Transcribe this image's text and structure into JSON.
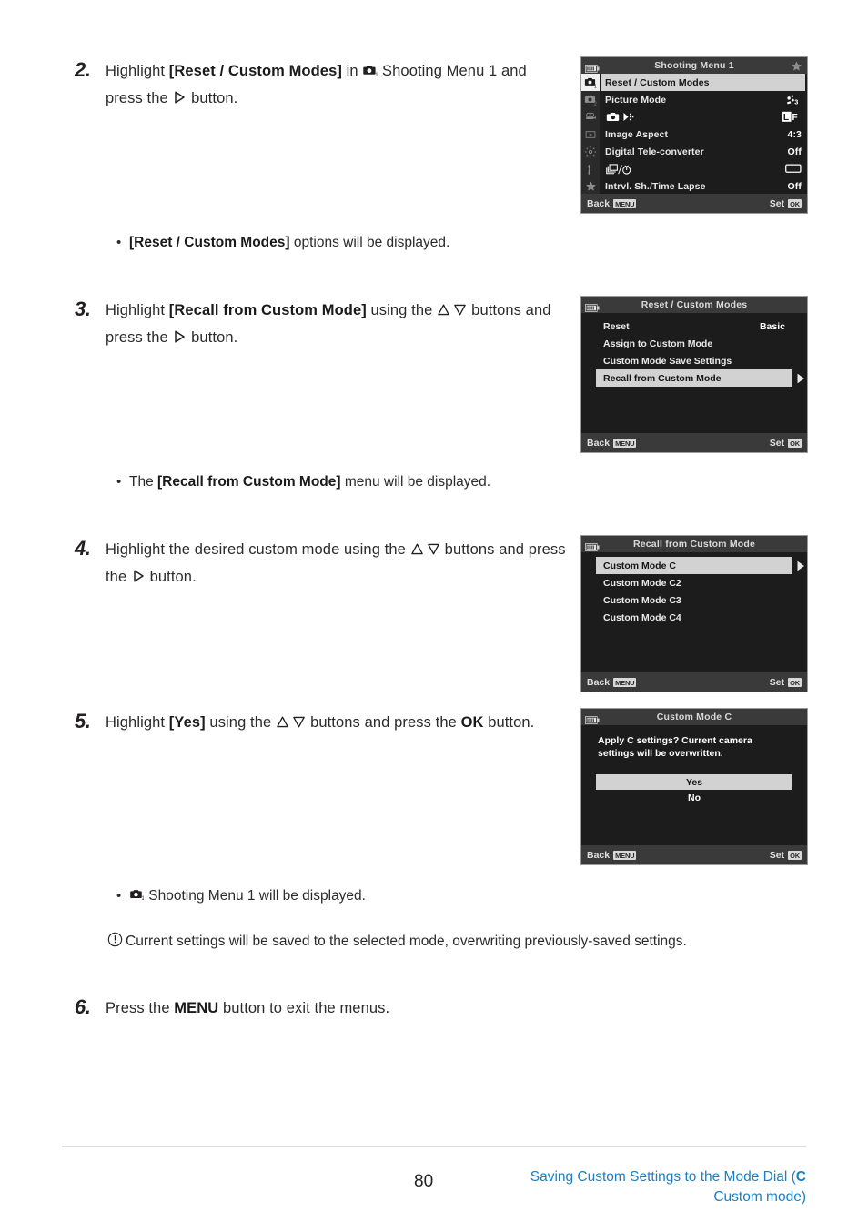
{
  "page": {
    "number": "80",
    "footer_link_line1_pre": "Saving Custom Settings to the Mode Dial (",
    "footer_link_bold": "C",
    "footer_link_line2": "Custom mode)",
    "accent_color": "#1b7fc4"
  },
  "steps": [
    {
      "num": "2.",
      "text_parts": {
        "p1": "Highlight ",
        "b1": "[Reset / Custom Modes]",
        "p2": " in ",
        "icon1": "camera-menu-1-icon",
        "p3": " Shooting Menu 1 and press the ",
        "icon2": "right-arrow-button-icon",
        "p4": " button."
      },
      "plain": "Highlight [Reset / Custom Modes] in Shooting Menu 1 and press the  button."
    },
    {
      "num": "3.",
      "text_parts": {
        "p1": "Highlight ",
        "b1": "[Recall from Custom Mode]",
        "p2": " using the ",
        "icon1": "up-arrow-button-icon",
        "icon2": "down-arrow-button-icon",
        "p3": " buttons and press the ",
        "icon3": "right-arrow-button-icon",
        "p4": " button."
      }
    },
    {
      "num": "4.",
      "text_parts": {
        "p1": "Highlight the desired custom mode using the ",
        "icon1": "up-arrow-button-icon",
        "icon2": "down-arrow-button-icon",
        "p2": " buttons and press the ",
        "icon3": "right-arrow-button-icon",
        "p3": " button."
      }
    },
    {
      "num": "5.",
      "text_parts": {
        "p1": "Highlight ",
        "b1": "[Yes]",
        "p2": " using the ",
        "icon1": "up-arrow-button-icon",
        "icon2": "down-arrow-button-icon",
        "p3": " buttons and press the ",
        "b2": "OK",
        "p4": " button."
      }
    },
    {
      "num": "6.",
      "text_parts": {
        "p1": "Press the ",
        "b1": "MENU",
        "p2": " button to exit the menus."
      }
    }
  ],
  "bullets": [
    {
      "b1": "[Reset / Custom Modes]",
      "p1": " options will be displayed."
    },
    {
      "p0": "The ",
      "b1": "[Recall from Custom Mode]",
      "p1": " menu will be displayed."
    },
    {
      "icon": "camera-menu-1-icon",
      "p1": " Shooting Menu 1 will be displayed."
    }
  ],
  "note": {
    "icon": "circled-exclamation-icon",
    "text": "Current settings will be saved to the selected mode, overwriting previously-saved settings."
  },
  "screens": [
    {
      "id": "shooting-menu-1",
      "title": "Shooting Menu 1",
      "battery_icon": "battery-icon",
      "star_icon": "star-icon",
      "rail": [
        {
          "icon": "camera-menu-1-icon",
          "selected": true
        },
        {
          "icon": "camera-menu-2-icon",
          "selected": false
        },
        {
          "icon": "movie-menu-icon",
          "selected": false
        },
        {
          "icon": "playback-menu-icon",
          "selected": false
        },
        {
          "icon": "custom-gear-menu-icon",
          "selected": false
        },
        {
          "icon": "setup-wrench-menu-icon",
          "selected": false
        },
        {
          "icon": "my-menu-star-icon",
          "selected": false
        }
      ],
      "rows": [
        {
          "label": "Reset / Custom Modes",
          "value": "",
          "highlight": true
        },
        {
          "label": "Picture Mode",
          "value": "",
          "value_icon": "picture-mode-natural-icon",
          "highlight": false
        },
        {
          "label": "",
          "label_icon": "image-quality-icon",
          "value": "",
          "value_icon": "large-fine-icon",
          "highlight": false
        },
        {
          "label": "Image Aspect",
          "value": "4:3",
          "highlight": false
        },
        {
          "label": "Digital Tele-converter",
          "value": "Off",
          "highlight": false
        },
        {
          "label": "",
          "label_icon": "drive-selftimer-icon",
          "value": "",
          "value_icon": "single-frame-icon",
          "highlight": false
        },
        {
          "label": "Intrvl. Sh./Time Lapse",
          "value": "Off",
          "highlight": false
        }
      ],
      "footer": {
        "back_label": "Back",
        "back_key": "MENU",
        "set_label": "Set",
        "set_key": "OK"
      }
    },
    {
      "id": "reset-custom-modes",
      "title": "Reset / Custom Modes",
      "battery_icon": "battery-icon",
      "rows": [
        {
          "label": "Reset",
          "value": "Basic",
          "highlight": false
        },
        {
          "label": "Assign to Custom Mode",
          "value": "",
          "highlight": false
        },
        {
          "label": "Custom Mode Save Settings",
          "value": "",
          "highlight": false
        },
        {
          "label": "Recall from Custom Mode",
          "value": "",
          "highlight": true,
          "arrow": true
        }
      ],
      "footer": {
        "back_label": "Back",
        "back_key": "MENU",
        "set_label": "Set",
        "set_key": "OK"
      }
    },
    {
      "id": "recall-from-custom-mode",
      "title": "Recall from Custom Mode",
      "battery_icon": "battery-icon",
      "rows": [
        {
          "label": "Custom Mode C",
          "value": "",
          "highlight": true,
          "arrow": true
        },
        {
          "label": "Custom Mode C2",
          "value": "",
          "highlight": false
        },
        {
          "label": "Custom Mode C3",
          "value": "",
          "highlight": false
        },
        {
          "label": "Custom Mode C4",
          "value": "",
          "highlight": false
        }
      ],
      "footer": {
        "back_label": "Back",
        "back_key": "MENU",
        "set_label": "Set",
        "set_key": "OK"
      }
    },
    {
      "id": "custom-mode-c-confirm",
      "title": "Custom Mode C",
      "battery_icon": "battery-icon",
      "message": "Apply C settings? Current camera settings will be overwritten.",
      "buttons": [
        {
          "label": "Yes",
          "highlight": true
        },
        {
          "label": "No",
          "highlight": false
        }
      ],
      "footer": {
        "back_label": "Back",
        "back_key": "MENU",
        "set_label": "Set",
        "set_key": "OK"
      }
    }
  ]
}
